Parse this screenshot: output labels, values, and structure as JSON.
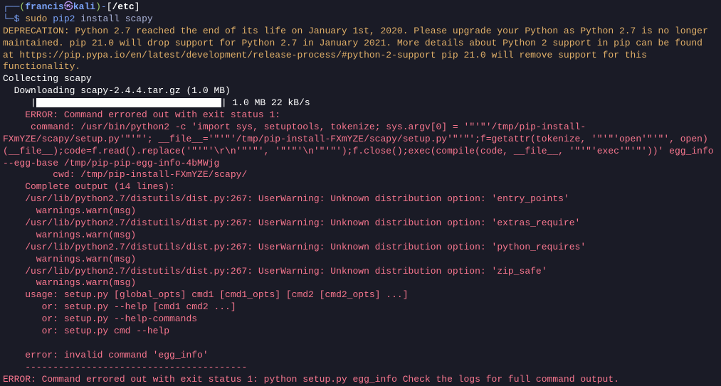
{
  "prompt": {
    "user": "francis",
    "at": "㉿",
    "host": "kali",
    "path": "/etc",
    "symbol": "$"
  },
  "command": {
    "sudo": "sudo",
    "pip": "pip2",
    "args": "install scapy"
  },
  "deprecation": "DEPRECATION: Python 2.7 reached the end of its life on January 1st, 2020. Please upgrade your Python as Python 2.7 is no longer maintained. pip 21.0 will drop support for Python 2.7 in January 2021. More details about Python 2 support in pip can be found at https://pip.pypa.io/en/latest/development/release-process/#python-2-support pip 21.0 will remove support for this functionality.",
  "collecting": "Collecting scapy",
  "downloading": "  Downloading scapy-2.4.4.tar.gz (1.0 MB)",
  "progress": {
    "prefix": "     |",
    "suffix": "| 1.0 MB 22 kB/s"
  },
  "error_header": "    ERROR: Command errored out with exit status 1:",
  "error_command": "     command: /usr/bin/python2 -c 'import sys, setuptools, tokenize; sys.argv[0] = '\"'\"'/tmp/pip-install-FXmYZE/scapy/setup.py'\"'\"'; __file__='\"'\"'/tmp/pip-install-FXmYZE/scapy/setup.py'\"'\"';f=getattr(tokenize, '\"'\"'open'\"'\"', open)(__file__);code=f.read().replace('\"'\"'\\r\\n'\"'\"', '\"'\"'\\n'\"'\"');f.close();exec(compile(code, __file__, '\"'\"'exec'\"'\"'))' egg_info --egg-base /tmp/pip-pip-egg-info-4bMWjg",
  "error_cwd": "         cwd: /tmp/pip-install-FXmYZE/scapy/",
  "complete_output": "    Complete output (14 lines):",
  "warnings": [
    "    /usr/lib/python2.7/distutils/dist.py:267: UserWarning: Unknown distribution option: 'entry_points'",
    "      warnings.warn(msg)",
    "    /usr/lib/python2.7/distutils/dist.py:267: UserWarning: Unknown distribution option: 'extras_require'",
    "      warnings.warn(msg)",
    "    /usr/lib/python2.7/distutils/dist.py:267: UserWarning: Unknown distribution option: 'python_requires'",
    "      warnings.warn(msg)",
    "    /usr/lib/python2.7/distutils/dist.py:267: UserWarning: Unknown distribution option: 'zip_safe'",
    "      warnings.warn(msg)"
  ],
  "usage": [
    "    usage: setup.py [global_opts] cmd1 [cmd1_opts] [cmd2 [cmd2_opts] ...]",
    "       or: setup.py --help [cmd1 cmd2 ...]",
    "       or: setup.py --help-commands",
    "       or: setup.py cmd --help"
  ],
  "blank": "    ",
  "invalid_cmd": "    error: invalid command 'egg_info'",
  "dashes": "    ----------------------------------------",
  "final_error": "ERROR: Command errored out with exit status 1: python setup.py egg_info Check the logs for full command output."
}
